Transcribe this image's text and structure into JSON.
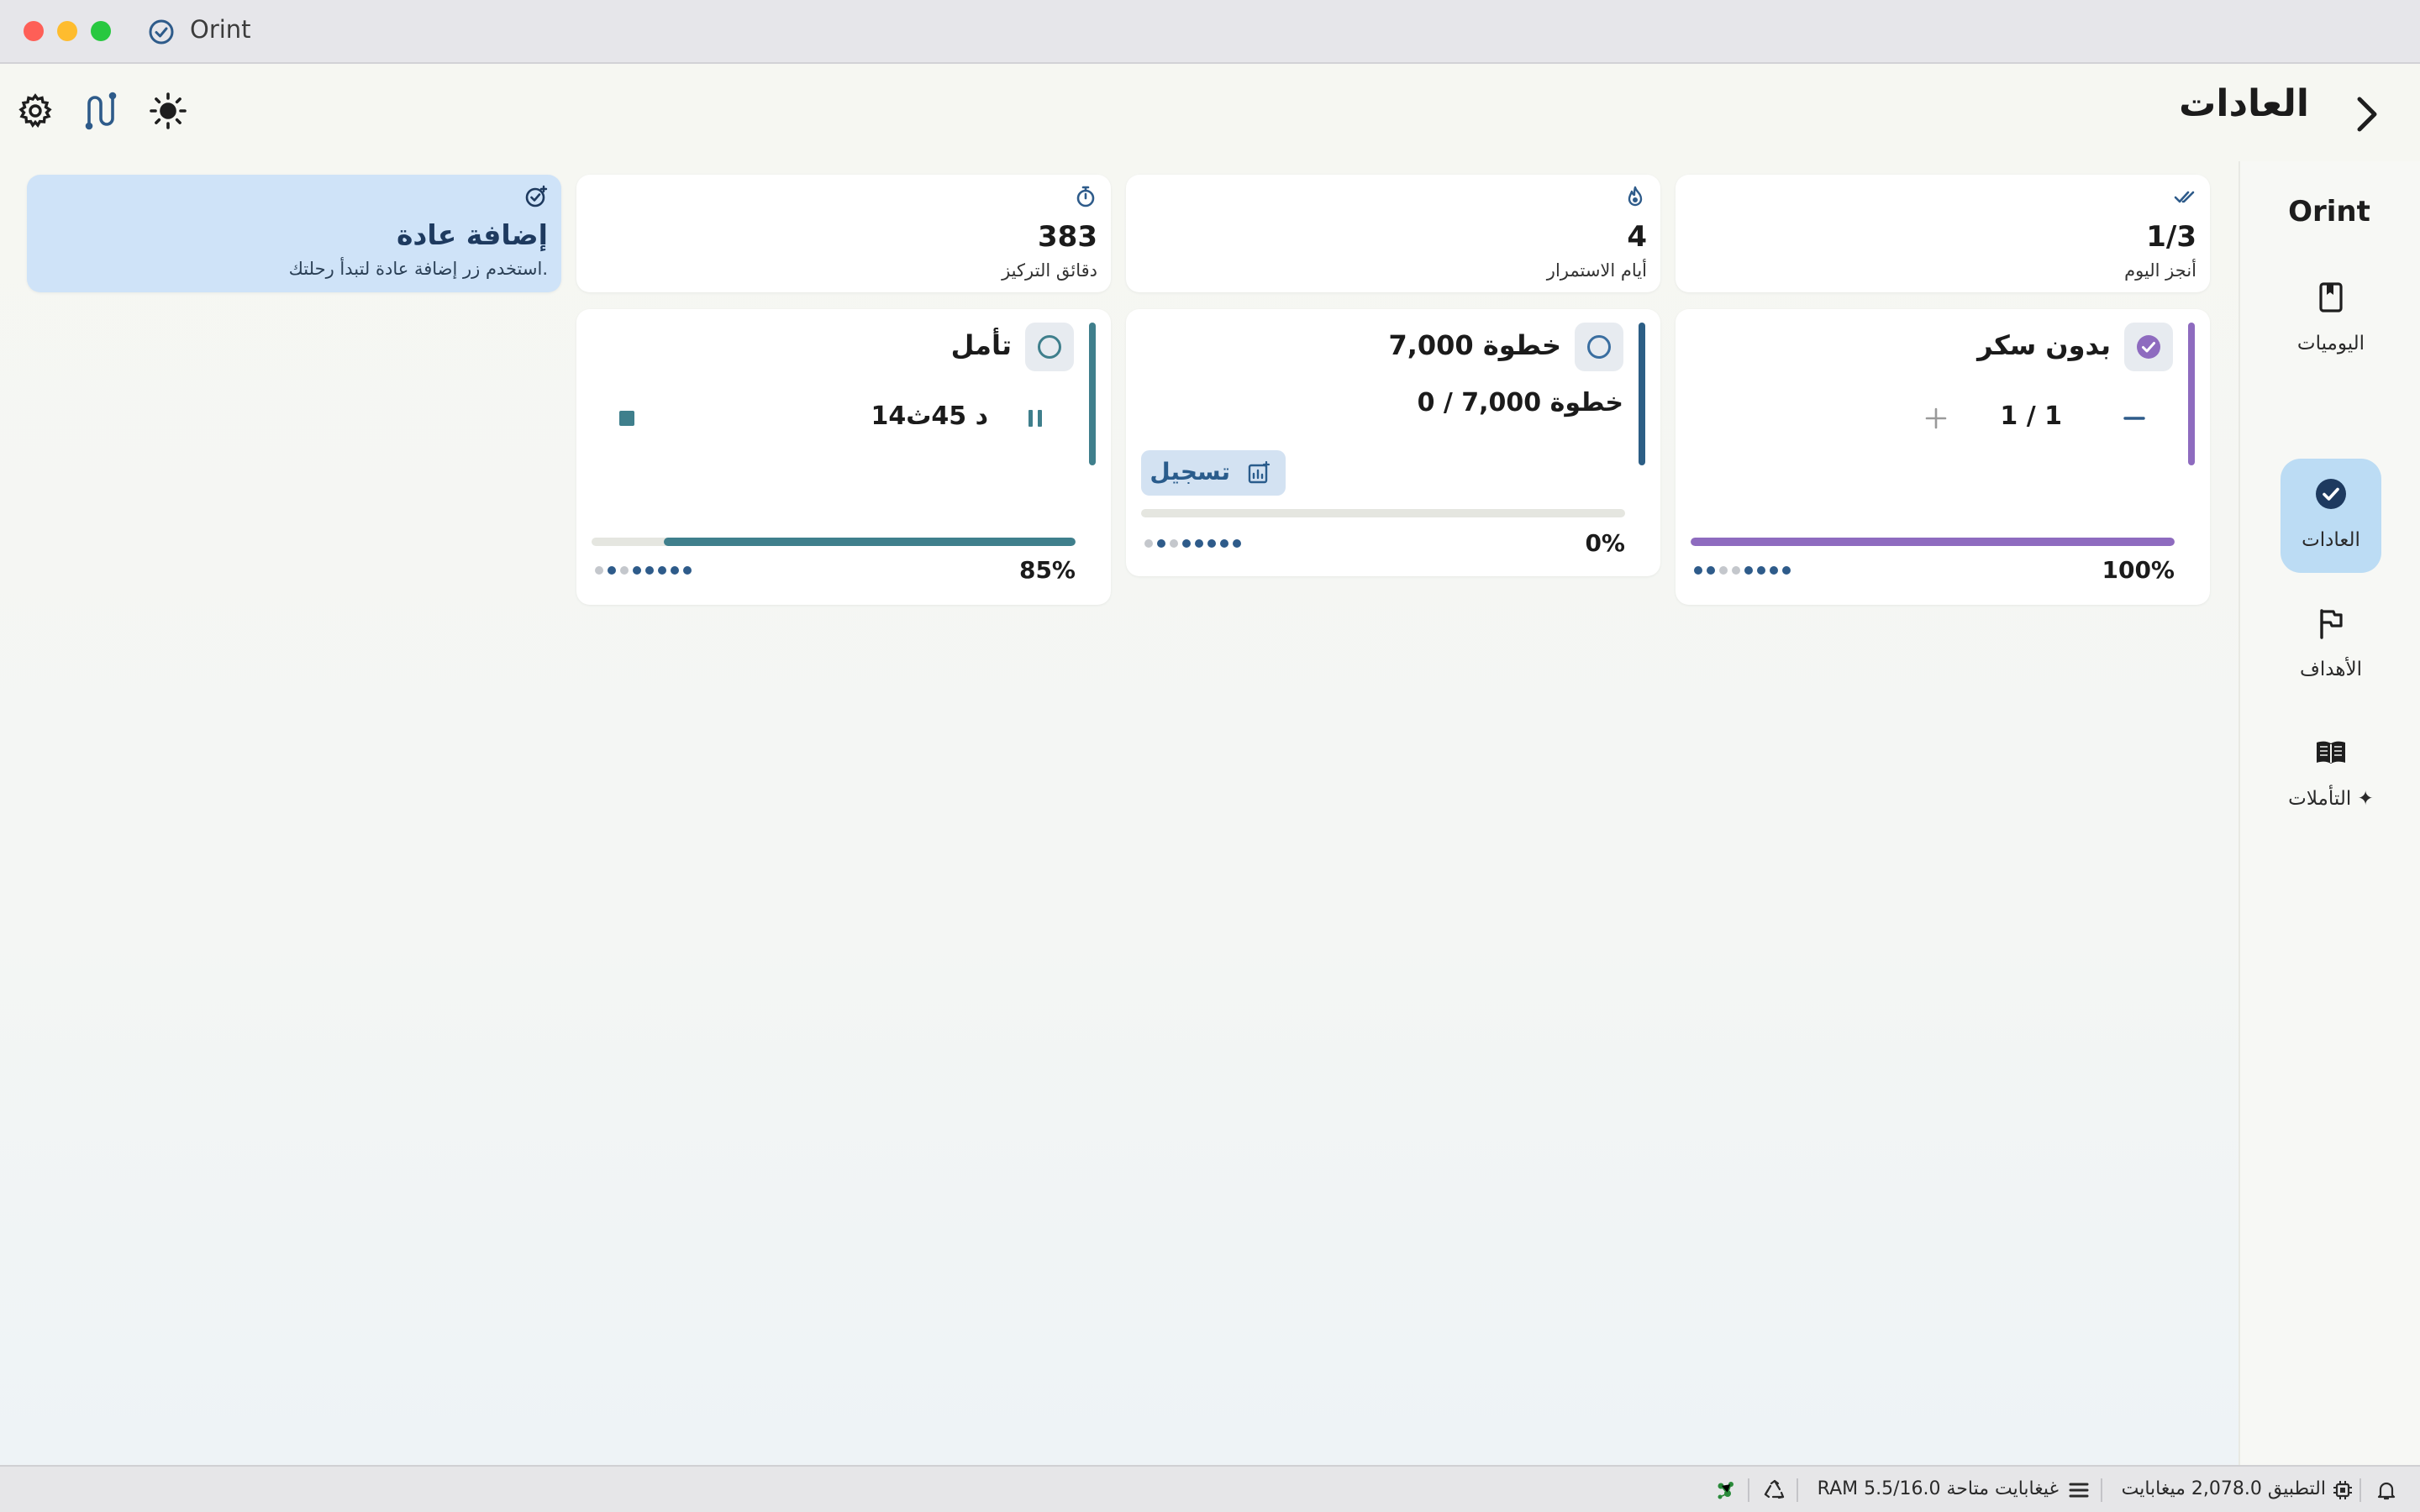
{
  "window": {
    "title": "Orint"
  },
  "header": {
    "title": "العادات"
  },
  "sidebar": {
    "brand": "Orint",
    "items": [
      {
        "label": "اليوميات",
        "icon": "bookmark-icon"
      },
      {
        "label": "العادات",
        "icon": "check-circle-icon",
        "active": true
      },
      {
        "label": "الأهداف",
        "icon": "flag-icon"
      },
      {
        "label": "التأملات ✦",
        "icon": "book-icon"
      }
    ]
  },
  "stats": [
    {
      "value": "1/3",
      "label": "أنجز اليوم",
      "icon": "double-check-icon"
    },
    {
      "value": "4",
      "label": "أيام الاستمرار",
      "icon": "flame-icon"
    },
    {
      "value": "383",
      "label": "دقائق التركيز",
      "icon": "stopwatch-icon"
    }
  ],
  "add_card": {
    "title": "إضافة عادة",
    "hint": "استخدم زر إضافة عادة لتبدأ رحلتك.",
    "icon": "add-check-icon"
  },
  "habits": [
    {
      "name": "بدون سكر",
      "done": true,
      "counter": "1 / 1",
      "progress": 1.0,
      "percent": "100%",
      "accent": "#8e6bbf",
      "history": [
        1,
        1,
        0,
        0,
        1,
        1,
        1,
        1
      ]
    },
    {
      "name": "7,000 خطوة",
      "done": false,
      "counter": "0 / 7,000 خطوة",
      "log_label": "تسجيل",
      "progress": 0.0,
      "percent": "0%",
      "accent": "#2c5e85",
      "history": [
        0,
        1,
        0,
        1,
        1,
        1,
        1,
        1
      ]
    },
    {
      "name": "تأمل",
      "done": false,
      "timer": "14د 45ث",
      "progress": 0.85,
      "percent": "85%",
      "accent": "#3f7f8c",
      "history": [
        0,
        1,
        0,
        1,
        1,
        1,
        1,
        1
      ]
    }
  ],
  "statusbar": {
    "app_memory": "التطبيق 2,078.0 ميغابايت",
    "ram": "RAM 5.5/16.0 غيغابايت متاحة"
  },
  "colors": {
    "accent_blue": "#2e5b8a",
    "active_nav": "#bcdcf4",
    "add_card_bg": "#cfe3f8"
  }
}
